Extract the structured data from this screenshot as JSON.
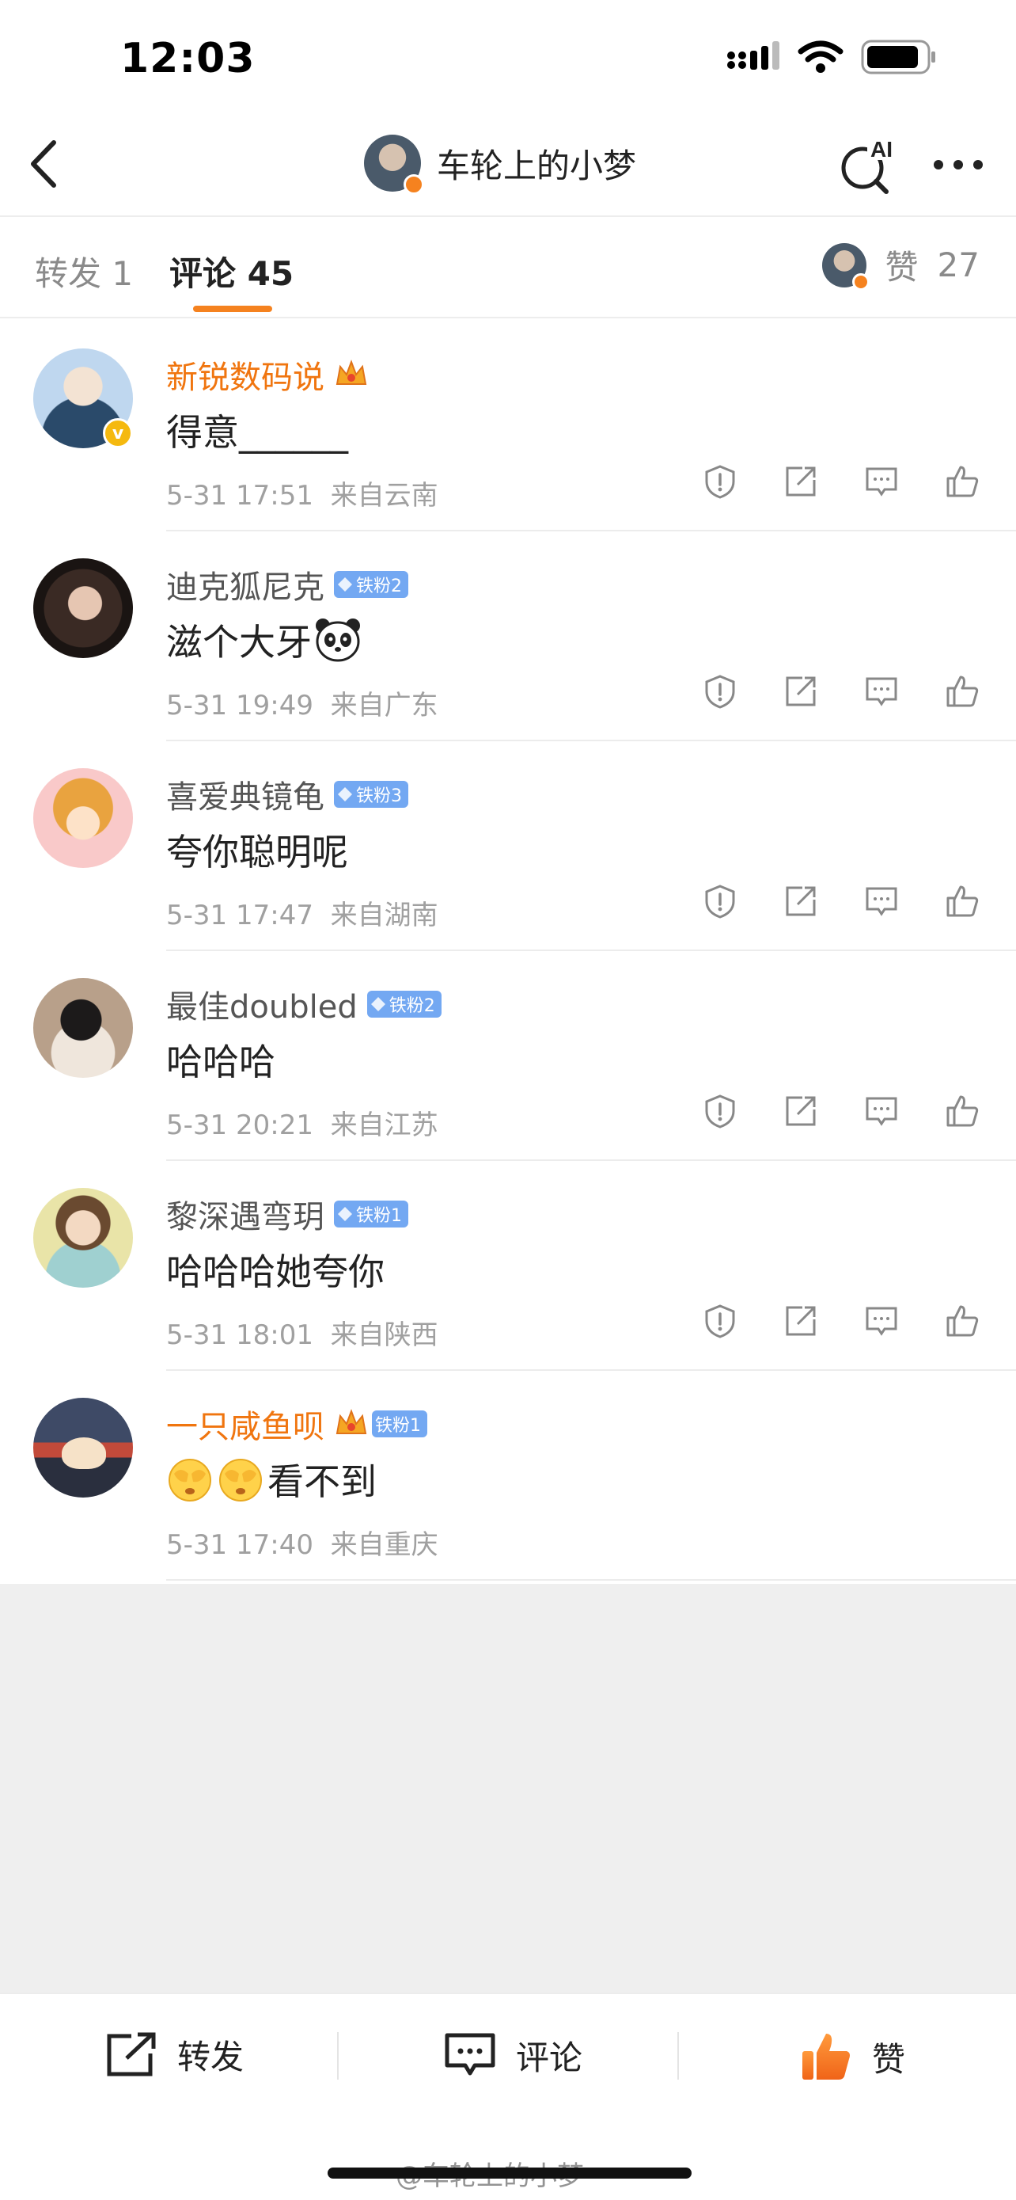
{
  "status_bar": {
    "time": "12:03"
  },
  "nav": {
    "title": "车轮上的小梦",
    "ai_label": "AI"
  },
  "tabs": {
    "repost": "转发 1",
    "comment": "评论 45",
    "likes_label": "赞",
    "likes_count": "27"
  },
  "comments": [
    {
      "username": "新锐数码说",
      "text": "得意______",
      "time": "5-31 17:51",
      "location": "来自云南",
      "badge": ""
    },
    {
      "username": "迪克狐尼克",
      "text": "滋个大牙",
      "time": "5-31 19:49",
      "location": "来自广东",
      "badge": "铁粉2"
    },
    {
      "username": "喜爱典镜龟",
      "text": "夸你聪明呢",
      "time": "5-31 17:47",
      "location": "来自湖南",
      "badge": "铁粉3"
    },
    {
      "username": "最佳doubled",
      "text": "哈哈哈",
      "time": "5-31 20:21",
      "location": "来自江苏",
      "badge": "铁粉2"
    },
    {
      "username": "黎深遇弯玥",
      "text": "哈哈哈她夸你",
      "time": "5-31 18:01",
      "location": "来自陕西",
      "badge": "铁粉1"
    },
    {
      "username": "一只咸鱼呗",
      "text": "看不到",
      "time": "5-31 17:40",
      "location": "来自重庆",
      "badge": "铁粉1"
    }
  ],
  "bottom_bar": {
    "repost": "转发",
    "comment": "评论",
    "like": "赞"
  },
  "watermark": "@车轮上的小梦",
  "colors": {
    "accent": "#f5821f",
    "fan_badge": "#73a8f2",
    "vip_name": "#f0750f"
  }
}
